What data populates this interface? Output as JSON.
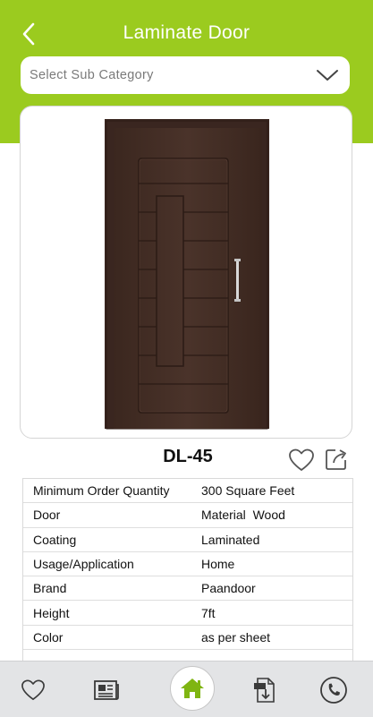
{
  "header": {
    "title": "Laminate Door",
    "back_icon": "chevron-left-icon"
  },
  "subcategory": {
    "placeholder": "Select Sub Category",
    "icon": "chevron-down-icon"
  },
  "product": {
    "code": "DL-45",
    "image": "door-image"
  },
  "specs": [
    {
      "label": "Minimum Order Quantity",
      "value": "300 Square Feet"
    },
    {
      "label": "Door",
      "value": "Material  Wood"
    },
    {
      "label": "Coating",
      "value": "Laminated"
    },
    {
      "label": "Usage/Application",
      "value": "Home"
    },
    {
      "label": "Brand",
      "value": "Paandoor"
    },
    {
      "label": "Height",
      "value": "7ft"
    },
    {
      "label": "Color",
      "value": "as per sheet"
    }
  ],
  "bottom_nav": [
    "heart-icon",
    "catalog-icon",
    "home-icon",
    "pdf-icon",
    "phone-icon"
  ],
  "colors": {
    "brand_green": "#9bcb1f",
    "nav_bg": "#e3e4e6",
    "door_wood": "#3f2a22"
  }
}
